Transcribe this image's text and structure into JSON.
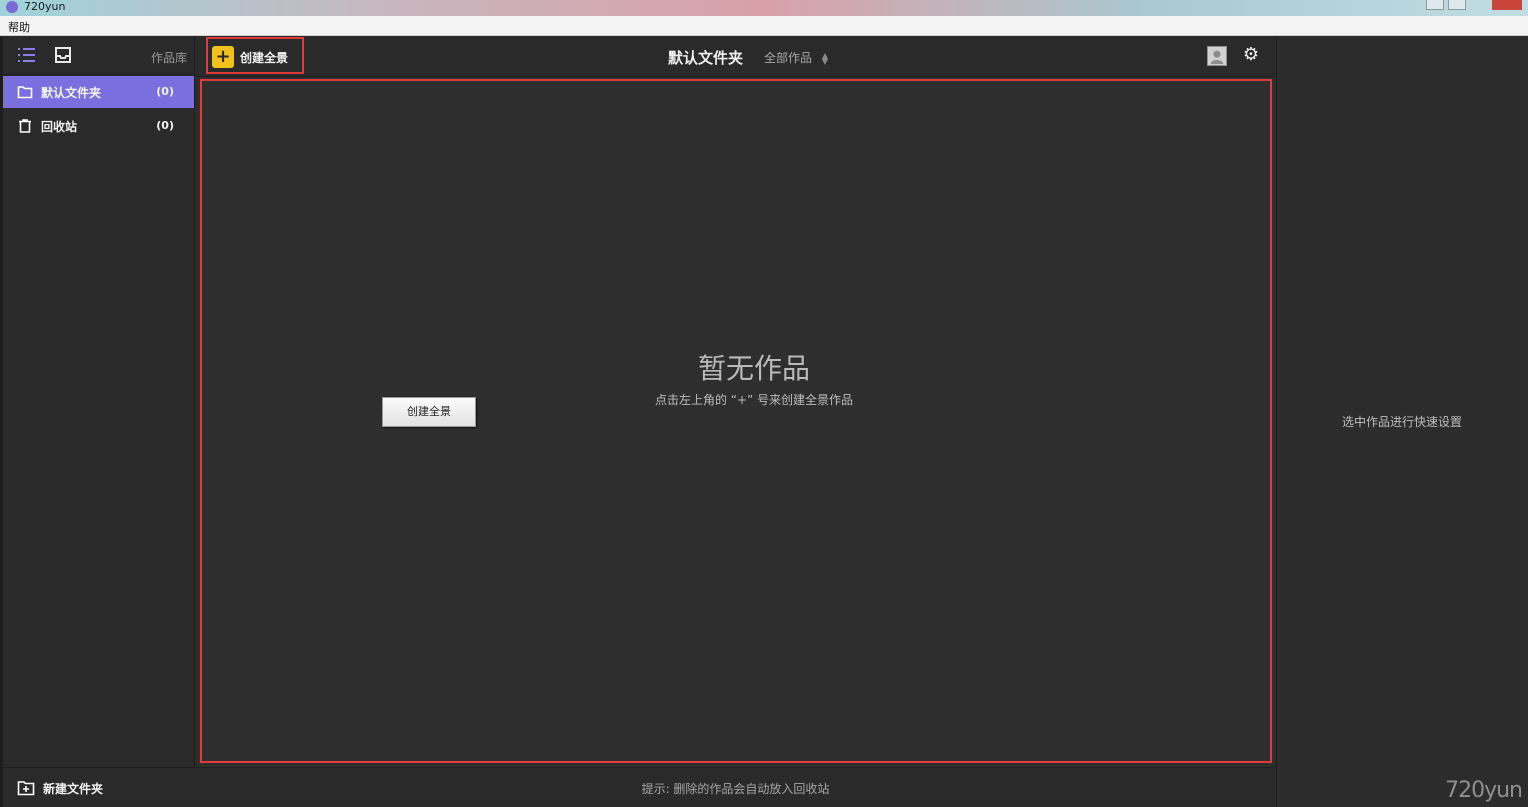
{
  "window": {
    "app_title": "720yun",
    "menu": [
      "帮助"
    ]
  },
  "sidebar": {
    "library_label": "作品库",
    "folders": [
      {
        "name": "默认文件夹",
        "count": "(0)",
        "active": true,
        "icon": "folder-icon"
      },
      {
        "name": "回收站",
        "count": "(0)",
        "active": false,
        "icon": "trash-icon"
      }
    ],
    "new_folder_label": "新建文件夹"
  },
  "header": {
    "create_label": "创建全景",
    "folder_title": "默认文件夹",
    "filter_label": "全部作品"
  },
  "content": {
    "button_label": "创建全景",
    "empty_title": "暂无作品",
    "empty_hint": "点击左上角的 “+” 号来创建全景作品"
  },
  "status": {
    "tip": "提示: 删除的作品会自动放入回收站"
  },
  "right_panel": {
    "hint": "选中作品进行快速设置",
    "watermark": "720yun"
  },
  "colors": {
    "accent": "#7b6fe0",
    "highlight_border": "#e03a3a",
    "plus_yellow": "#f2c21a"
  }
}
